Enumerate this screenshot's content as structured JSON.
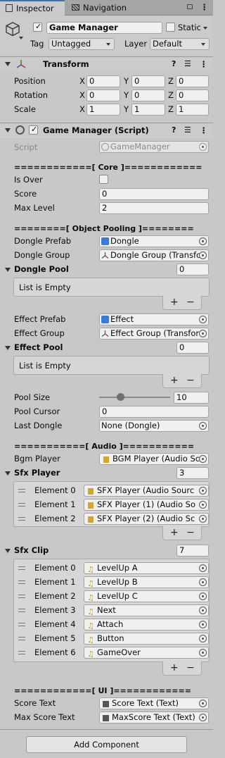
{
  "tabs": {
    "inspector": "Inspector",
    "navigation": "Navigation"
  },
  "gameobject": {
    "name": "Game Manager",
    "static_label": "Static",
    "tag_label": "Tag",
    "tag_value": "Untagged",
    "layer_label": "Layer",
    "layer_value": "Default"
  },
  "transform": {
    "title": "Transform",
    "position_label": "Position",
    "rotation_label": "Rotation",
    "scale_label": "Scale",
    "x": "X",
    "y": "Y",
    "z": "Z",
    "position": [
      "0",
      "0",
      "0"
    ],
    "rotation": [
      "0",
      "0",
      "0"
    ],
    "scale": [
      "1",
      "1",
      "1"
    ]
  },
  "script_component": {
    "title": "Game Manager (Script)",
    "script_label": "Script",
    "script_value": "GameManager",
    "core_header": "============[ Core ]============",
    "is_over_label": "Is Over",
    "score_label": "Score",
    "score_value": "0",
    "max_level_label": "Max Level",
    "max_level_value": "2",
    "pooling_header": "========[ Object Pooling ]========",
    "dongle_prefab_label": "Dongle Prefab",
    "dongle_prefab_value": "Dongle",
    "dongle_group_label": "Dongle Group",
    "dongle_group_value": "Dongle Group (Transfo",
    "dongle_pool_label": "Dongle Pool",
    "dongle_pool_count": "0",
    "dongle_pool_empty": "List is Empty",
    "effect_prefab_label": "Effect Prefab",
    "effect_prefab_value": "Effect",
    "effect_group_label": "Effect Group",
    "effect_group_value": "Effect Group (Transfor",
    "effect_pool_label": "Effect Pool",
    "effect_pool_count": "0",
    "effect_pool_empty": "List is Empty",
    "pool_size_label": "Pool Size",
    "pool_size_value": "10",
    "pool_cursor_label": "Pool Cursor",
    "pool_cursor_value": "0",
    "last_dongle_label": "Last Dongle",
    "last_dongle_value": "None (Dongle)",
    "audio_header": "===========[ Audio ]===========",
    "bgm_player_label": "Bgm Player",
    "bgm_player_value": "BGM Player (Audio Sc",
    "sfx_player_label": "Sfx Player",
    "sfx_player_count": "3",
    "sfx_players": [
      {
        "label": "Element 0",
        "value": "SFX Player (Audio Sourc"
      },
      {
        "label": "Element 1",
        "value": "SFX Player (1) (Audio So"
      },
      {
        "label": "Element 2",
        "value": "SFX Player (2) (Audio Sc"
      }
    ],
    "sfx_clip_label": "Sfx Clip",
    "sfx_clip_count": "7",
    "sfx_clips": [
      {
        "label": "Element 0",
        "value": "LevelUp A"
      },
      {
        "label": "Element 1",
        "value": "LevelUp B"
      },
      {
        "label": "Element 2",
        "value": "LevelUp C"
      },
      {
        "label": "Element 3",
        "value": "Next"
      },
      {
        "label": "Element 4",
        "value": "Attach"
      },
      {
        "label": "Element 5",
        "value": "Button"
      },
      {
        "label": "Element 6",
        "value": "GameOver"
      }
    ],
    "ui_header": "============[ UI ]============",
    "score_text_label": "Score Text",
    "score_text_value": "Score Text (Text)",
    "max_score_text_label": "Max Score Text",
    "max_score_text_value": "MaxScore Text (Text)"
  },
  "add_component_label": "Add Component",
  "pool_size_slider_fraction": 0.28,
  "colors": {
    "background": "#c8c8c8",
    "tab_active": "#cbcbcb",
    "field": "#f0f0f0",
    "border": "#a3a3a3"
  }
}
